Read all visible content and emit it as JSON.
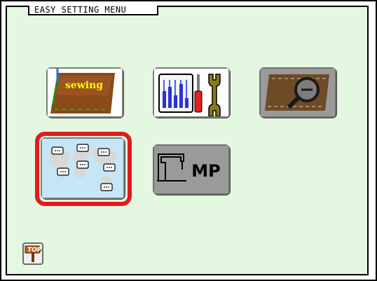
{
  "header": {
    "title": "EASY SETTING MENU"
  },
  "menu": {
    "sewing_label": "sewing",
    "mp_label": "MP",
    "selected_item": "language-settings"
  },
  "footer": {
    "top_label": "TOP"
  },
  "colors": {
    "panel_background": "#e3f7e1",
    "selection_ring": "#e41a1a",
    "sewing_cloth": "#8c4a1a",
    "sewing_label_text": "#ffff00"
  },
  "icons": {
    "sewing": "sewing-icon",
    "tools": "tools-icon",
    "inspection": "magnifier-icon",
    "language": "world-map-speech-icon",
    "mp": "sewing-machine-mp-icon",
    "top": "signpost-top-icon"
  }
}
